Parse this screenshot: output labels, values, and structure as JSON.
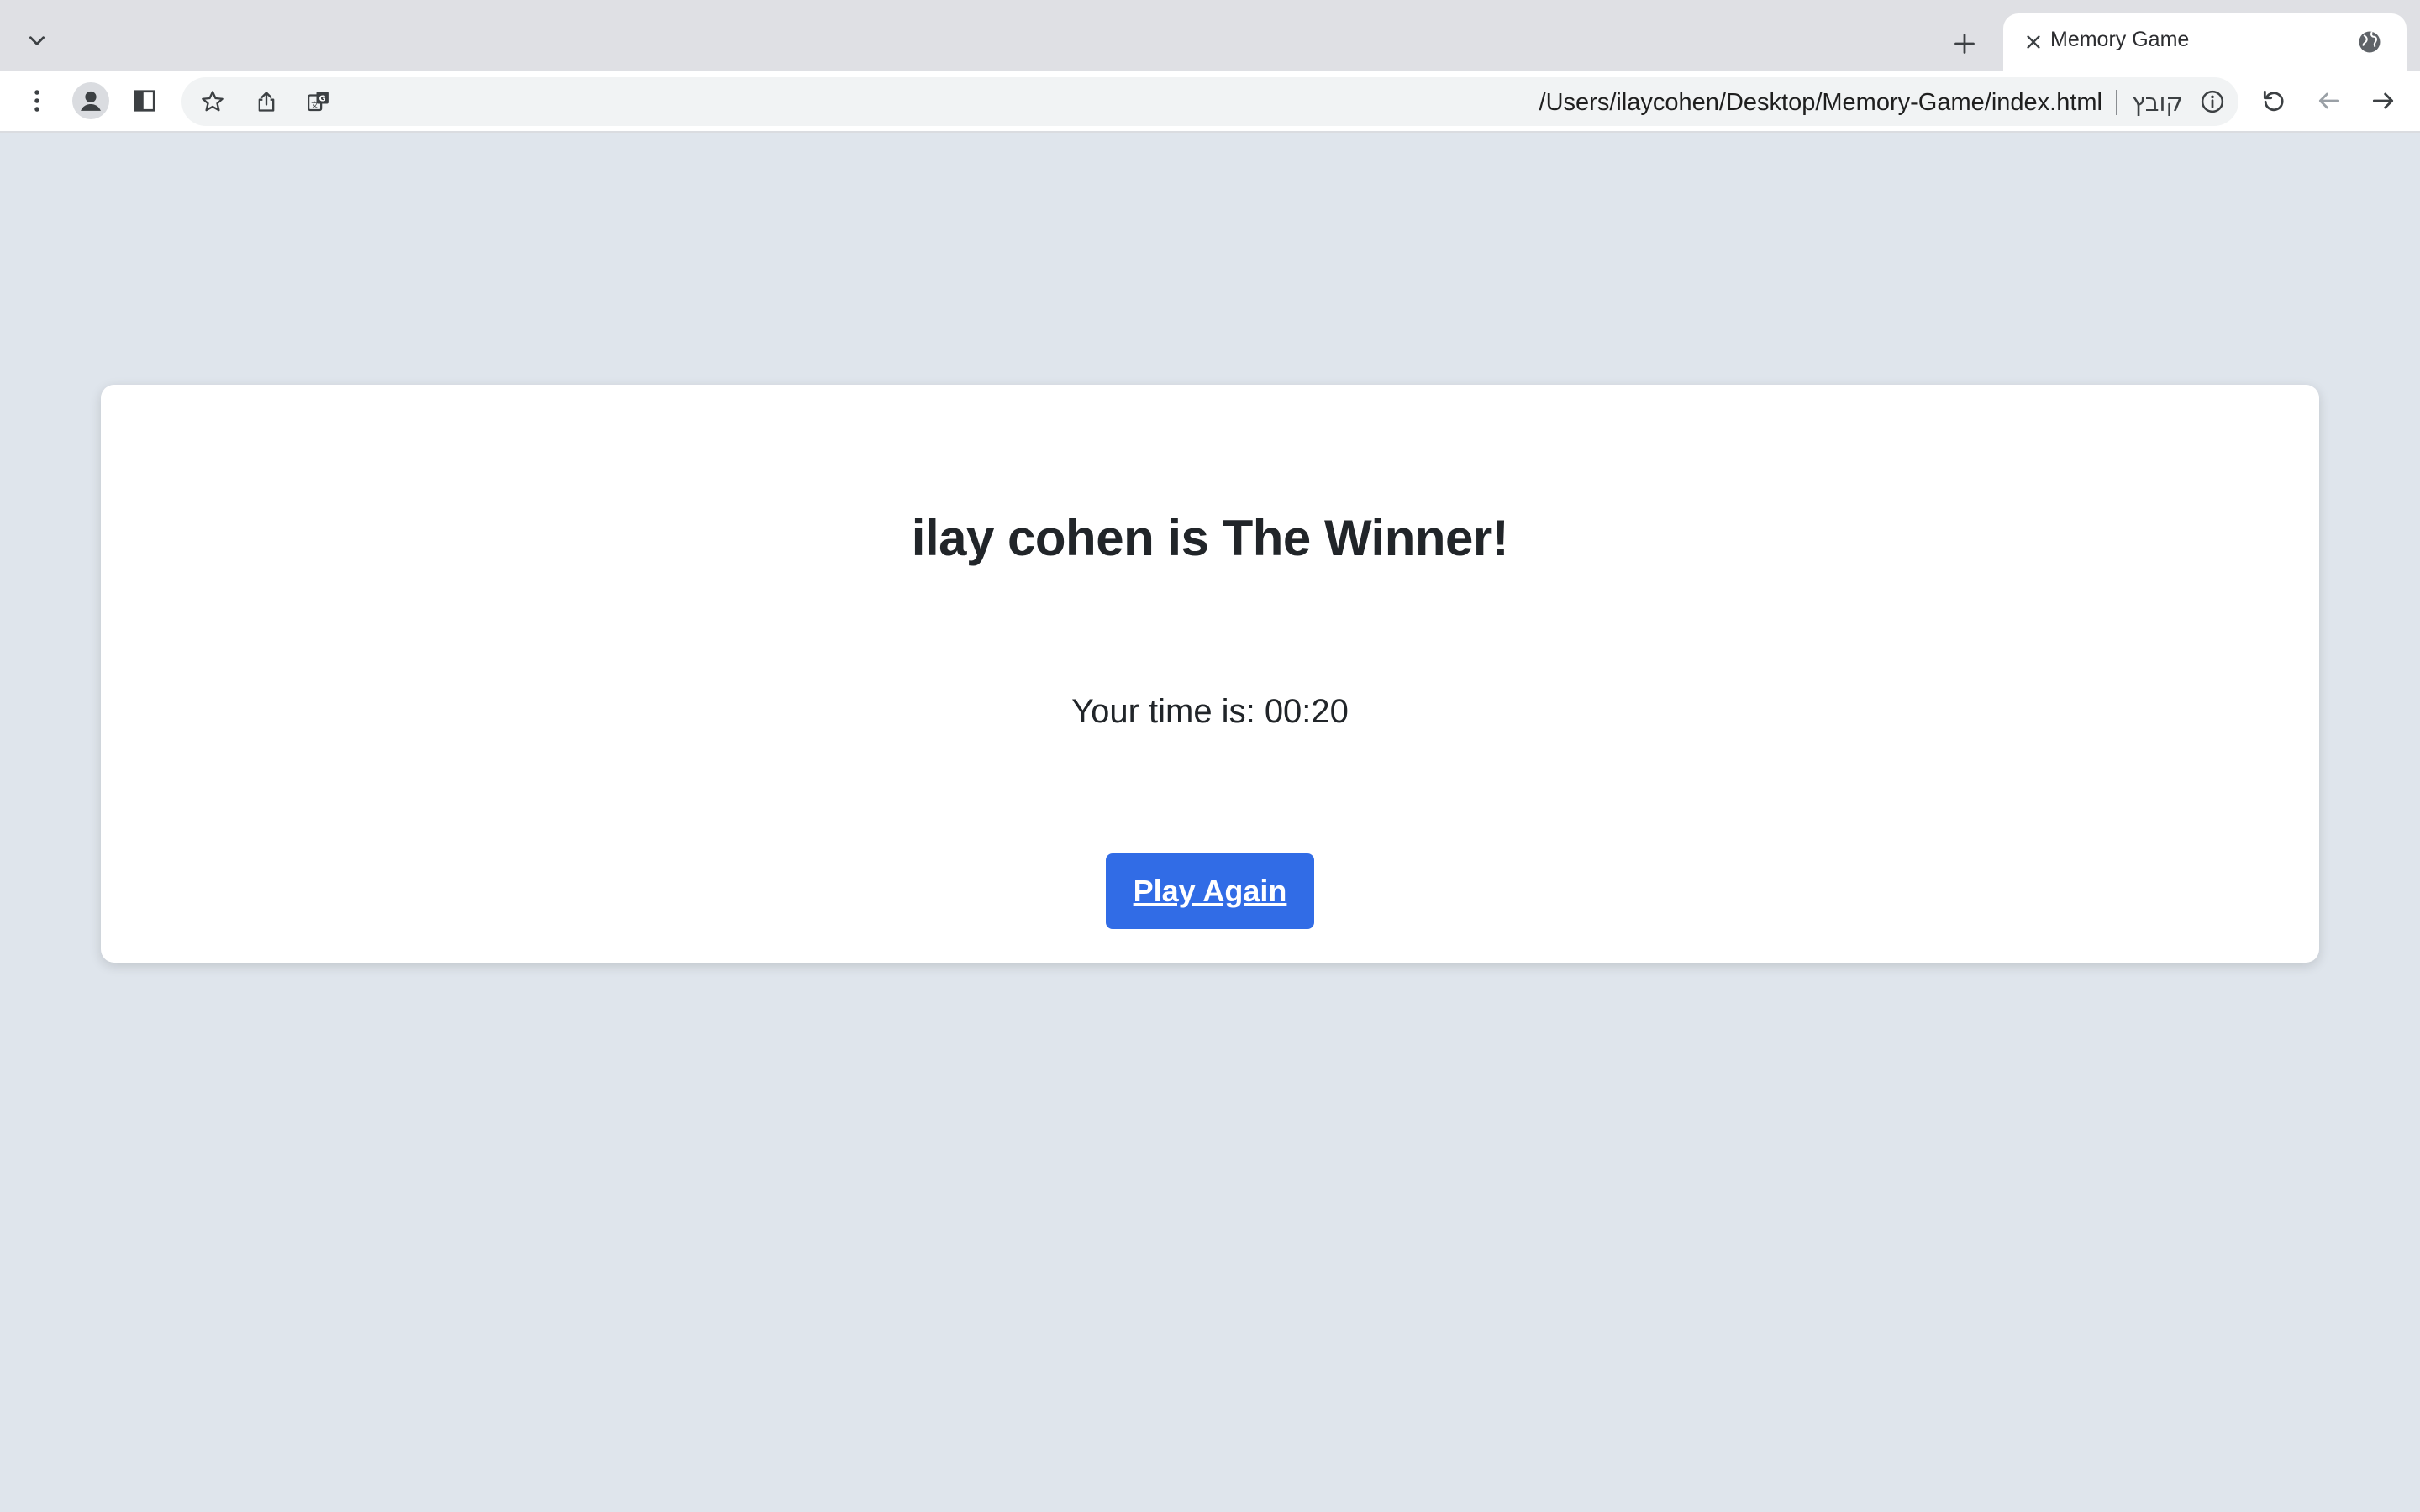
{
  "browser": {
    "tab": {
      "title": "Memory Game"
    },
    "omnibox": {
      "url": "/Users/ilaycohen/Desktop/Memory-Game/index.html",
      "scheme_label": "קובץ"
    },
    "icons": {
      "tab_list": "chevron-down-icon",
      "new_tab": "plus-icon",
      "tab_close": "close-icon",
      "tab_favicon": "globe-icon",
      "menu": "more-vert-icon",
      "profile": "profile-icon",
      "side_panel": "side-panel-icon",
      "bookmark": "star-icon",
      "share": "share-icon",
      "translate": "translate-icon",
      "site_info": "info-icon",
      "reload": "reload-icon",
      "back": "back-arrow-icon",
      "forward": "forward-arrow-icon"
    }
  },
  "page": {
    "winner_title": "ilay cohen is The Winner!",
    "time_label": "Your time is:",
    "time_value": "00:20",
    "play_again_label": "Play Again"
  },
  "colors": {
    "page_background": "#dfe5ec",
    "card_background": "#ffffff",
    "button_background": "#316ce6",
    "text": "#212529"
  }
}
